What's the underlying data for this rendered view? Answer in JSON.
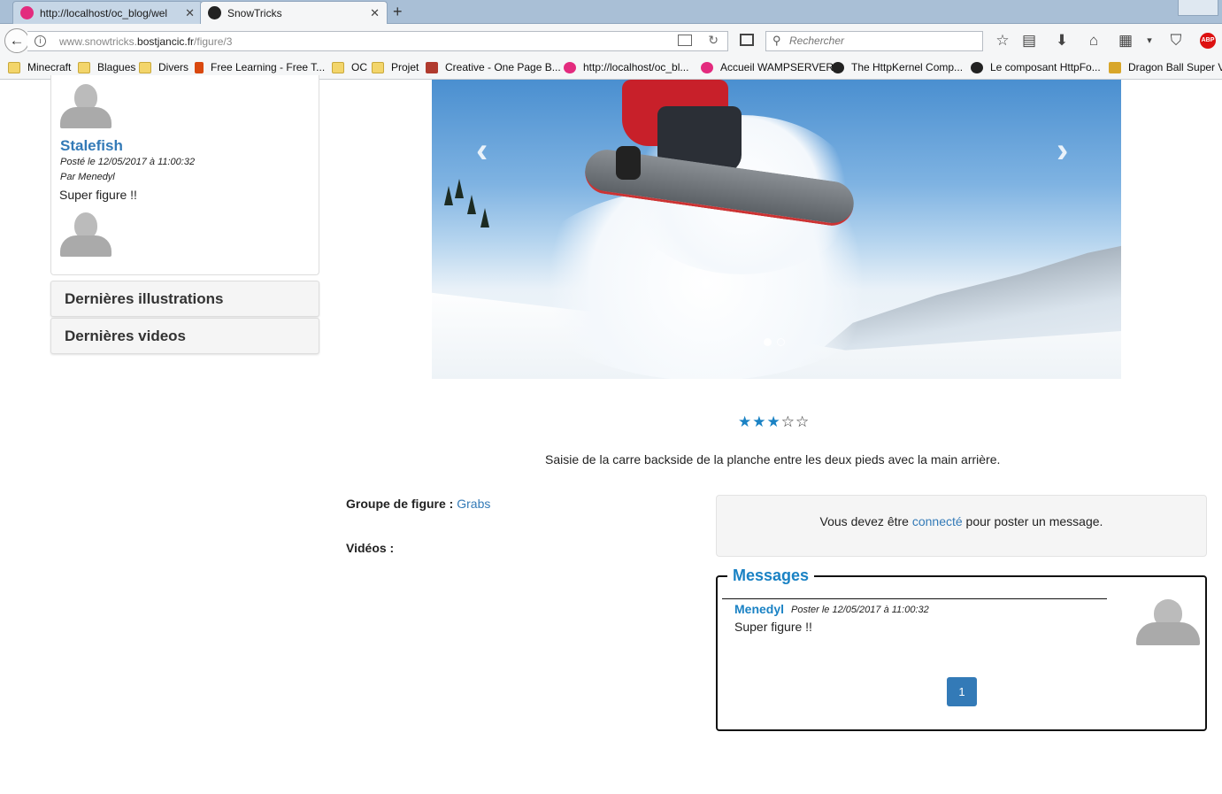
{
  "browser": {
    "tabs": [
      {
        "label": "http://localhost/oc_blog/wel",
        "active": false
      },
      {
        "label": "SnowTricks",
        "active": true
      }
    ],
    "url_prefix": "www.snowtricks.",
    "url_domain": "bostjancic.fr",
    "url_path": "/figure/3",
    "search_placeholder": "Rechercher",
    "bookmarks": [
      {
        "label": "Minecraft",
        "icon": "folder-icon"
      },
      {
        "label": "Blagues",
        "icon": "folder-icon"
      },
      {
        "label": "Divers",
        "icon": "folder-icon"
      },
      {
        "label": "Free Learning - Free T...",
        "icon": "packt-icon"
      },
      {
        "label": "OC",
        "icon": "folder-icon"
      },
      {
        "label": "Projet",
        "icon": "folder-icon"
      },
      {
        "label": "Creative - One Page B...",
        "icon": "s-logo-icon"
      },
      {
        "label": "http://localhost/oc_bl...",
        "icon": "wamp-icon"
      },
      {
        "label": "Accueil WAMPSERVER",
        "icon": "wamp-icon"
      },
      {
        "label": "The HttpKernel Comp...",
        "icon": "symfony-icon"
      },
      {
        "label": "Le composant HttpFo...",
        "icon": "symfony-icon"
      },
      {
        "label": "Dragon Ball Super V",
        "icon": "dragonball-icon"
      }
    ],
    "abp_label": "ABP"
  },
  "sidebar": {
    "comment": {
      "author": "Stalefish",
      "date": "Posté le 12/05/2017 à 11:00:32",
      "by": "Par Menedyl",
      "text": "Super figure !!"
    },
    "accordion": [
      {
        "label": "Dernières illustrations"
      },
      {
        "label": "Dernières videos"
      }
    ]
  },
  "figure": {
    "rating": 3,
    "rating_max": 5,
    "star_on": "★",
    "star_off": "☆",
    "description": "Saisie de la carre backside de la planche entre les deux pieds avec la main arrière.",
    "group_label": "Groupe de figure :",
    "group_value": "Grabs",
    "videos_label": "Vidéos :"
  },
  "login_notice": {
    "before": "Vous devez être ",
    "link": "connecté",
    "after": " pour poster un message."
  },
  "messages": {
    "title": "Messages",
    "items": [
      {
        "author": "Menedyl",
        "date": "Poster le 12/05/2017 à 11:00:32",
        "text": "Super figure !!"
      }
    ],
    "pages": [
      "1"
    ]
  },
  "colors": {
    "link": "#337ab7",
    "accent": "#1a82c4"
  }
}
